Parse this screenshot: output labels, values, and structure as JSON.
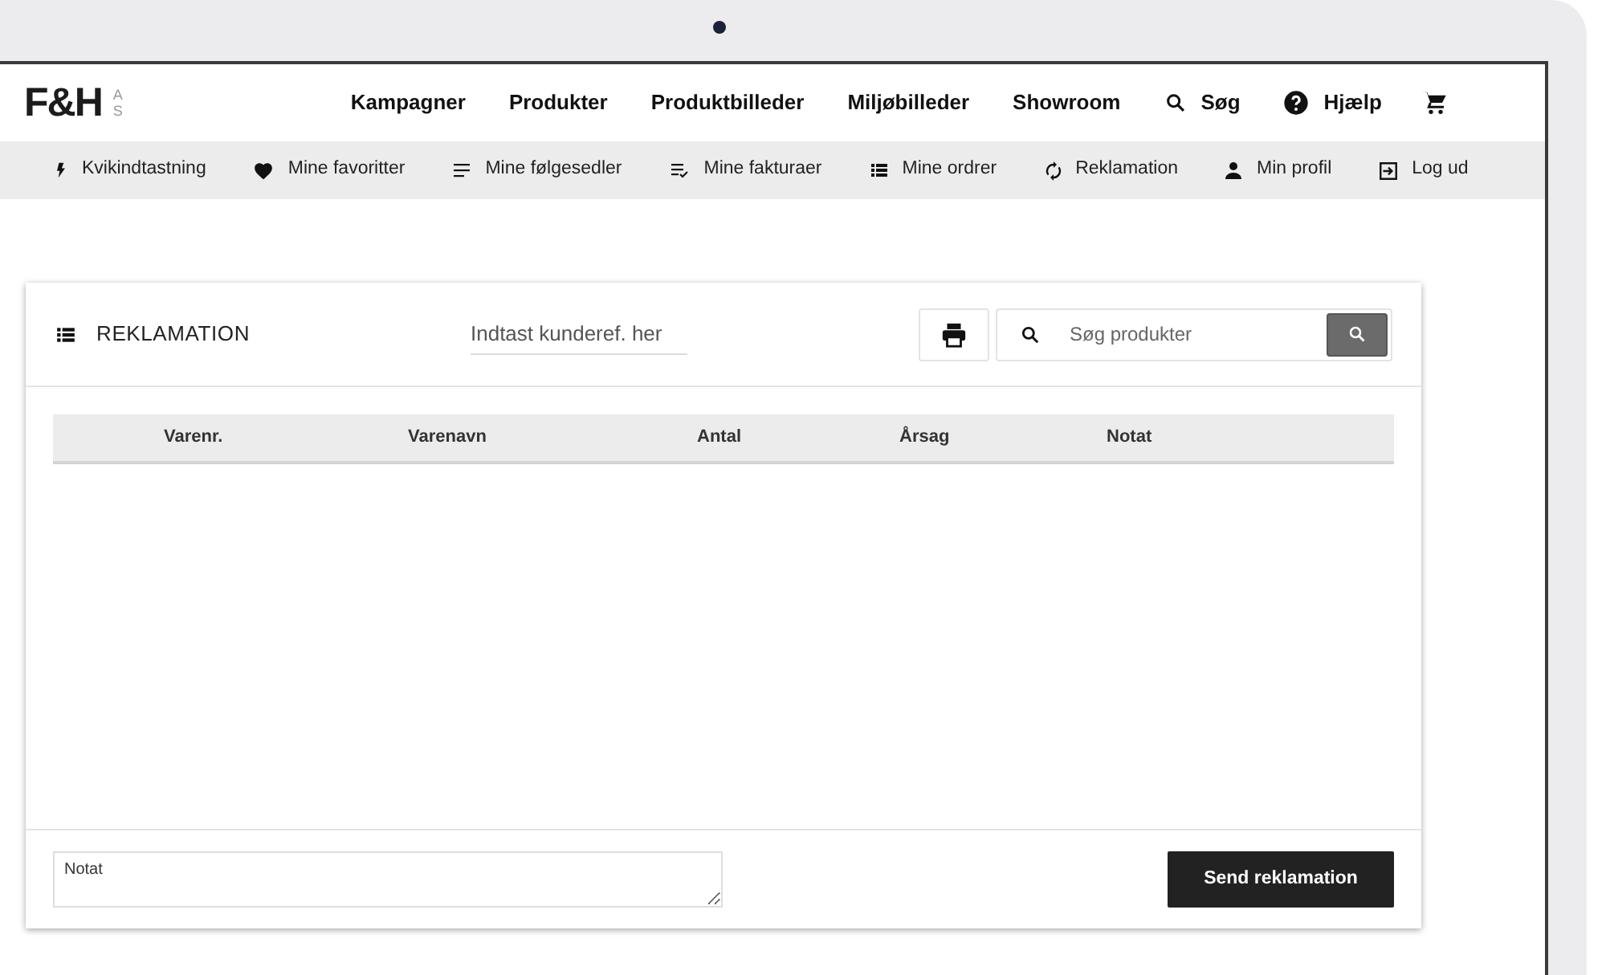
{
  "logo": {
    "text": "F&H",
    "suffix": [
      "A",
      "S"
    ]
  },
  "nav": [
    {
      "label": "Kampagner"
    },
    {
      "label": "Produkter"
    },
    {
      "label": "Produktbilleder"
    },
    {
      "label": "Miljøbilleder"
    },
    {
      "label": "Showroom"
    },
    {
      "label": "Søg"
    },
    {
      "label": "Hjælp"
    }
  ],
  "subnav": [
    {
      "label": "Kvikindtastning"
    },
    {
      "label": "Mine favoritter"
    },
    {
      "label": "Mine følgesedler"
    },
    {
      "label": "Mine fakturaer"
    },
    {
      "label": "Mine ordrer"
    },
    {
      "label": "Reklamation"
    },
    {
      "label": "Min profil"
    },
    {
      "label": "Log ud"
    }
  ],
  "card": {
    "title": "REKLAMATION",
    "customer_ref": {
      "placeholder": "Indtast kunderef. her"
    },
    "search": {
      "placeholder": "Søg produkter"
    },
    "table": {
      "columns": [
        "Varenr.",
        "Varenavn",
        "Antal",
        "Årsag",
        "Notat"
      ]
    },
    "note": {
      "placeholder": "Notat"
    },
    "submit": "Send reklamation"
  }
}
